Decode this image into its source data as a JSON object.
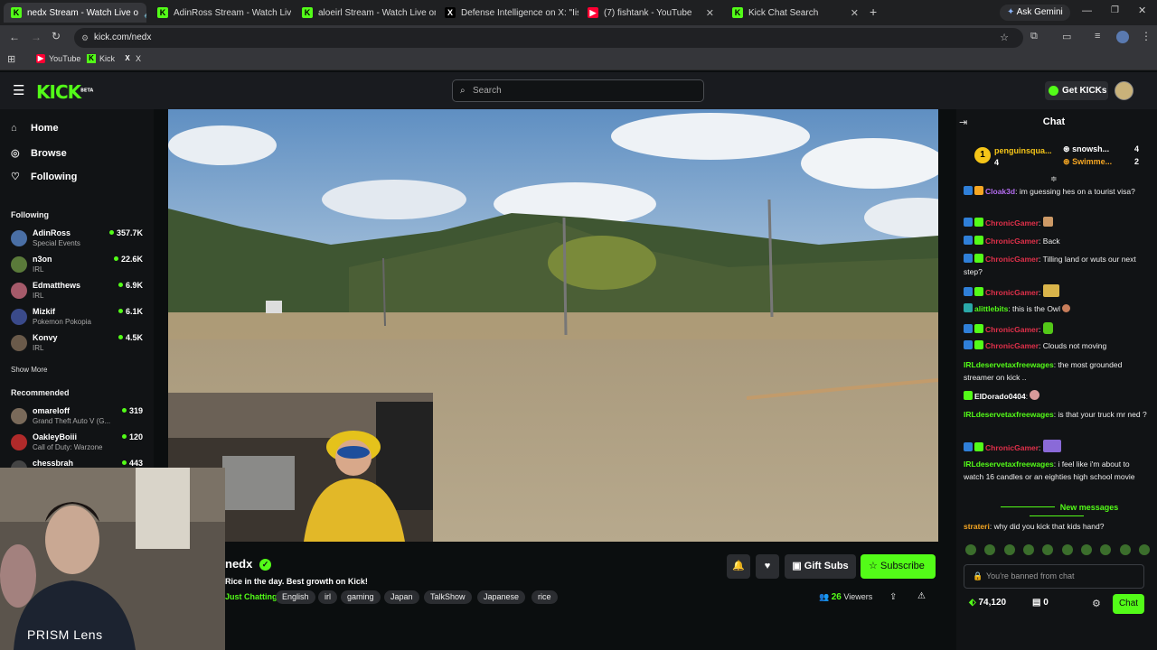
{
  "browser": {
    "tabs": [
      {
        "title": "nedx Stream - Watch Live o",
        "fav": "K"
      },
      {
        "title": "AdinRoss Stream - Watch Live o",
        "fav": "K"
      },
      {
        "title": "aloeirl Stream - Watch Live on",
        "fav": "K"
      },
      {
        "title": "Defense Intelligence on X: \"Iis",
        "fav": "X"
      },
      {
        "title": "(7) fishtank - YouTube",
        "fav": "▶"
      },
      {
        "title": "Kick Chat Search",
        "fav": "K"
      }
    ],
    "new_tab": "+",
    "ask_gemini": "Ask Gemini",
    "url": "kick.com/nedx",
    "bookmarks": [
      {
        "label": "YouTube",
        "fav": "▶"
      },
      {
        "label": "Kick",
        "fav": "K"
      },
      {
        "label": "X",
        "fav": "X"
      }
    ]
  },
  "header": {
    "logo": "KICK",
    "logo_sup": "BETA",
    "search_placeholder": "Search",
    "get_kicks": "Get KICKs"
  },
  "sidebar": {
    "nav": [
      {
        "label": "Home",
        "icon": "home-icon"
      },
      {
        "label": "Browse",
        "icon": "compass-icon"
      },
      {
        "label": "Following",
        "icon": "heart-icon"
      }
    ],
    "following_title": "Following",
    "following": [
      {
        "name": "AdinRoss",
        "category": "Special Events",
        "viewers": "357.7K",
        "color": "#4a6fa5"
      },
      {
        "name": "n3on",
        "category": "IRL",
        "viewers": "22.6K",
        "color": "#5a7a3a"
      },
      {
        "name": "Edmatthews",
        "category": "IRL",
        "viewers": "6.9K",
        "color": "#a55a6a"
      },
      {
        "name": "Mizkif",
        "category": "Pokemon Pokopia",
        "viewers": "6.1K",
        "color": "#3a4a8a"
      },
      {
        "name": "Konvy",
        "category": "IRL",
        "viewers": "4.5K",
        "color": "#6a5a4a"
      }
    ],
    "show_more": "Show More",
    "recommended_title": "Recommended",
    "recommended": [
      {
        "name": "omareloff",
        "category": "Grand Theft Auto V (G...",
        "viewers": "319",
        "color": "#7a6a5a"
      },
      {
        "name": "OakleyBoiii",
        "category": "Call of Duty: Warzone",
        "viewers": "120",
        "color": "#b02a2a"
      },
      {
        "name": "chessbrah",
        "category": "",
        "viewers": "443",
        "color": "#444444"
      }
    ]
  },
  "stream": {
    "name": "nedx",
    "title": "Rice in the day. Best growth on Kick!",
    "category": "Just Chatting",
    "tags": [
      "English",
      "irl",
      "gaming",
      "Japan",
      "TalkShow",
      "Japanese",
      "rice"
    ],
    "gift_subs": "Gift Subs",
    "subscribe": "Subscribe",
    "viewers_count": "26",
    "viewers_label": "Viewers",
    "overlay_label": "PRISM Lens"
  },
  "chat": {
    "title": "Chat",
    "leaderboard": [
      {
        "rank": "1",
        "name": "penguinsqua...",
        "count": "4"
      },
      {
        "name": "snowsh...",
        "count": "4"
      },
      {
        "name": "Swimme...",
        "count": "2"
      }
    ],
    "messages": [
      {
        "user": "Cloak3d",
        "color": "#b46cf0",
        "text": "im guessing hes on a tourist visa?"
      },
      {
        "user": "ChronicGamer",
        "color": "#e0304a",
        "text": ""
      },
      {
        "user": "ChronicGamer",
        "color": "#e0304a",
        "text": "Back"
      },
      {
        "user": "ChronicGamer",
        "color": "#e0304a",
        "text": "Tilling land or wuts our next step?"
      },
      {
        "user": "ChronicGamer",
        "color": "#e0304a",
        "text": ""
      },
      {
        "user": "alittlebits",
        "color": "#53fc18",
        "text": "this is the Owl"
      },
      {
        "user": "ChronicGamer",
        "color": "#e0304a",
        "text": ""
      },
      {
        "user": "ChronicGamer",
        "color": "#e0304a",
        "text": "Clouds not moving"
      },
      {
        "user": "IRLdeservetaxfreewages",
        "color": "#53fc18",
        "text": "the most grounded streamer on kick .."
      },
      {
        "user": "ElDorado0404",
        "color": "#fff",
        "text": ""
      },
      {
        "user": "IRLdeservetaxfreewages",
        "color": "#53fc18",
        "text": "is that your truck mr ned ?"
      },
      {
        "user": "ChronicGamer",
        "color": "#e0304a",
        "text": ""
      },
      {
        "user": "IRLdeservetaxfreewages",
        "color": "#53fc18",
        "text": "i feel like i'm about to watch 16 candles or an eighties high school movie"
      }
    ],
    "new_messages": "New messages",
    "latest": {
      "user": "strateri",
      "color": "#f5a623",
      "text": "why did you kick that kids hand?"
    },
    "banned_placeholder": "You're banned from chat",
    "points": "74,120",
    "subs_count": "0",
    "chat_button": "Chat"
  },
  "colors": {
    "accent": "#53fc18",
    "bg": "#0b0e0f",
    "panel": "#111315"
  }
}
